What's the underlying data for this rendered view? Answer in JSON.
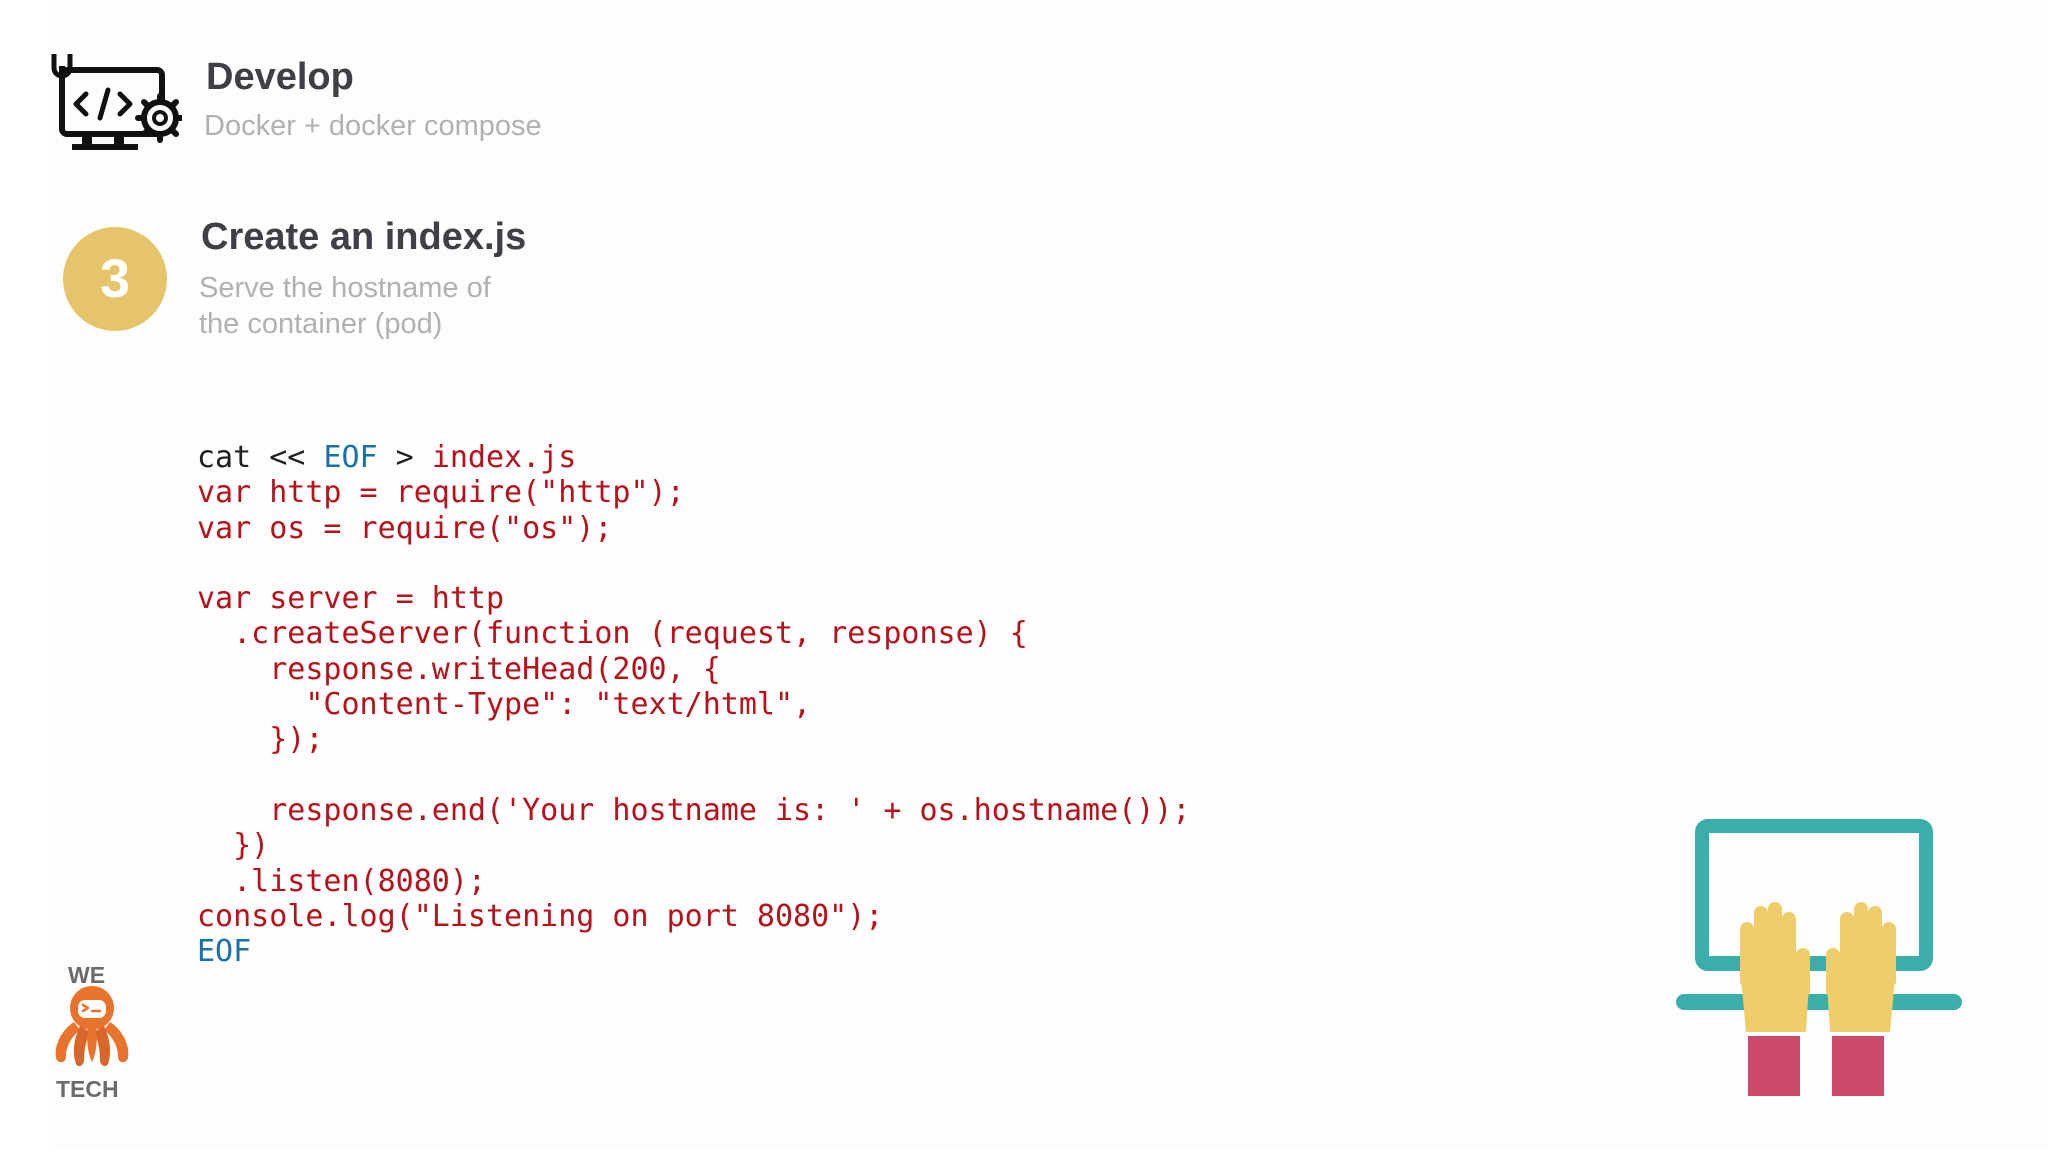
{
  "header": {
    "icon": "code-monitor-icon",
    "title": "Develop",
    "subtitle": "Docker + docker compose"
  },
  "step": {
    "number": "3",
    "title": "Create an index.js",
    "description": "Serve the hostname of the container (pod)"
  },
  "code": {
    "language": "bash-heredoc-javascript",
    "lines": [
      [
        {
          "t": "cat << ",
          "k": "plain"
        },
        {
          "t": "EOF",
          "k": "kw"
        },
        {
          "t": " > ",
          "k": "plain"
        },
        {
          "t": "index.js",
          "k": "str"
        }
      ],
      [
        {
          "t": "var http = require(\"http\");",
          "k": "str"
        }
      ],
      [
        {
          "t": "var os = require(\"os\");",
          "k": "str"
        }
      ],
      [
        {
          "t": "",
          "k": "str"
        }
      ],
      [
        {
          "t": "var server = http",
          "k": "str"
        }
      ],
      [
        {
          "t": "  .createServer(function (request, response) {",
          "k": "str"
        }
      ],
      [
        {
          "t": "    response.writeHead(200, {",
          "k": "str"
        }
      ],
      [
        {
          "t": "      \"Content-Type\": \"text/html\",",
          "k": "str"
        }
      ],
      [
        {
          "t": "    });",
          "k": "str"
        }
      ],
      [
        {
          "t": "",
          "k": "str"
        }
      ],
      [
        {
          "t": "    response.end('Your hostname is: ' + os.hostname());",
          "k": "str"
        }
      ],
      [
        {
          "t": "  })",
          "k": "str"
        }
      ],
      [
        {
          "t": "  .listen(8080);",
          "k": "str"
        }
      ],
      [
        {
          "t": "console.log(\"Listening on port 8080\");",
          "k": "str"
        }
      ],
      [
        {
          "t": "EOF",
          "k": "kw"
        }
      ]
    ]
  },
  "logo": {
    "top_text": "WE",
    "bottom_text": "TECH",
    "icon": "octopus-mascot-icon"
  },
  "illustration": {
    "icon": "laptop-typing-hands-icon"
  },
  "colors": {
    "accent_circle": "#e6c46a",
    "title_text": "#3f3f46",
    "subtitle_text": "#b1b1b5",
    "code_string": "#b5121b",
    "code_keyword": "#1d6fa8",
    "code_plain": "#1f1f1f",
    "laptop_teal": "#3aafa9",
    "hand_yellow": "#f0cd6b",
    "sleeve_pink": "#cc4a6e",
    "mascot_orange": "#e8732c"
  }
}
